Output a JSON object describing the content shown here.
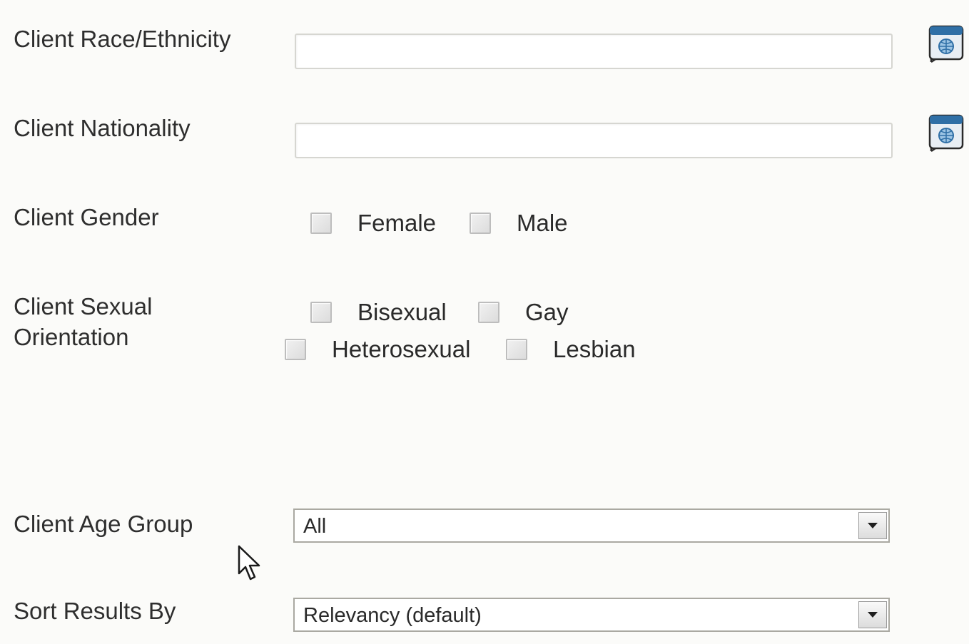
{
  "fields": {
    "race": {
      "label": "Client Race/Ethnicity",
      "value": "",
      "lookup_icon": "lookup-globe-icon"
    },
    "nationality": {
      "label": "Client Nationality",
      "value": "",
      "lookup_icon": "lookup-globe-icon"
    },
    "gender": {
      "label": "Client Gender",
      "options": [
        "Female",
        "Male"
      ]
    },
    "orientation": {
      "label_line1": "Client Sexual",
      "label_line2": "Orientation",
      "options": [
        "Bisexual",
        "Gay",
        "Heterosexual",
        "Lesbian"
      ]
    },
    "age_group": {
      "label": "Client Age Group",
      "selected": "All"
    },
    "sort": {
      "label": "Sort Results By",
      "selected": "Relevancy (default)"
    }
  },
  "colors": {
    "background": "#fbfbf9",
    "lookup_icon_blue": "#2f6fa6"
  }
}
